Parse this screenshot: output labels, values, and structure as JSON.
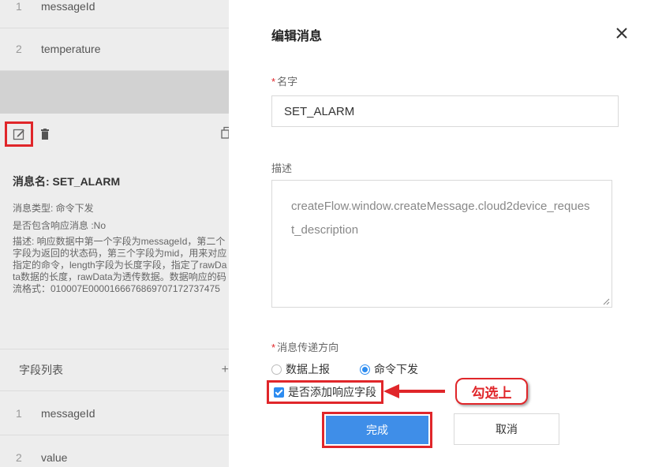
{
  "left_panel": {
    "top_fields": [
      {
        "index": "1",
        "name": "messageId"
      },
      {
        "index": "2",
        "name": "temperature"
      }
    ],
    "message_name": "消息名: SET_ALARM",
    "message_type": "消息类型: 命令下发",
    "has_response": "是否包含响应消息 :No",
    "description": "描述: 响应数据中第一个字段为messageId，第二个字段为返回的状态码，第三个字段为mid，用来对应指定的命令，length字段为长度字段，指定了rawData数据的长度，rawData为透传数据。数据响应的码流格式：010007E0000166676869707172737475",
    "fields_list_label": "字段列表",
    "fields_list_plus": "+",
    "bottom_fields": [
      {
        "index": "1",
        "name": "messageId"
      },
      {
        "index": "2",
        "name": "value"
      }
    ]
  },
  "dialog": {
    "title": "编辑消息",
    "name_label": "名字",
    "name_value": "SET_ALARM",
    "desc_label": "描述",
    "desc_value": "createFlow.window.createMessage.cloud2device_request_description",
    "direction_label": "消息传递方向",
    "direction_options": [
      "数据上报",
      "命令下发"
    ],
    "direction_selected": "命令下发",
    "add_response_label": "是否添加响应字段",
    "add_response_checked": true,
    "ok_label": "完成",
    "cancel_label": "取消"
  },
  "annotation": {
    "callout_text": "勾选上"
  },
  "colors": {
    "highlight_red": "#e0262a",
    "primary_blue": "#3f8ee8",
    "left_bg": "#ededed"
  }
}
